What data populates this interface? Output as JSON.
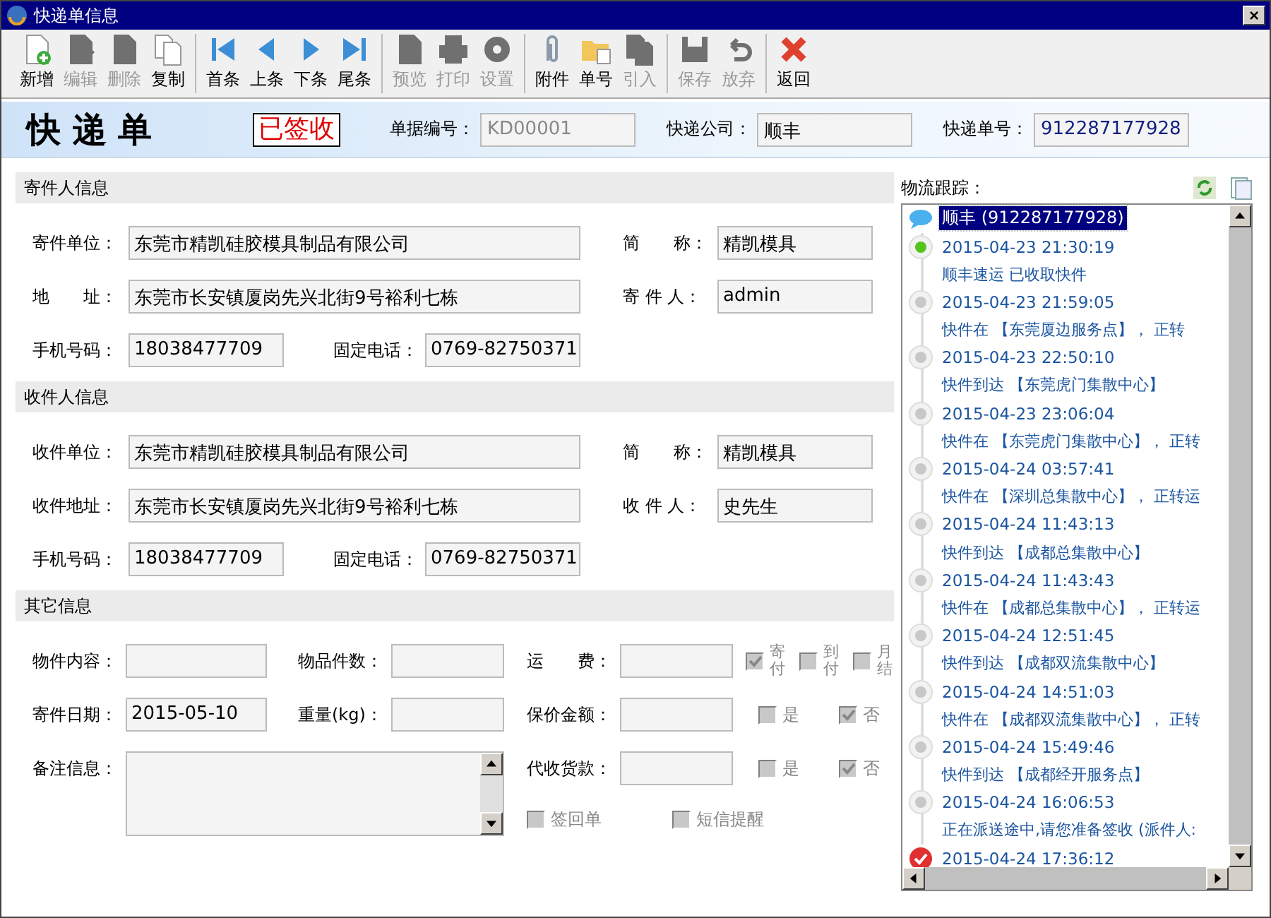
{
  "window": {
    "title": "快递单信息",
    "close": "×"
  },
  "toolbar": {
    "groups": [
      [
        {
          "label": "新增",
          "kind": "new",
          "disabled": false
        },
        {
          "label": "编辑",
          "kind": "edit",
          "disabled": true
        },
        {
          "label": "删除",
          "kind": "delete",
          "disabled": true
        },
        {
          "label": "复制",
          "kind": "copy",
          "disabled": false
        }
      ],
      [
        {
          "label": "首条",
          "kind": "first",
          "disabled": false
        },
        {
          "label": "上条",
          "kind": "previous",
          "disabled": false
        },
        {
          "label": "下条",
          "kind": "next",
          "disabled": false
        },
        {
          "label": "尾条",
          "kind": "last",
          "disabled": false
        }
      ],
      [
        {
          "label": "预览",
          "kind": "preview",
          "disabled": true
        },
        {
          "label": "打印",
          "kind": "print",
          "disabled": true
        },
        {
          "label": "设置",
          "kind": "settings",
          "disabled": true
        }
      ],
      [
        {
          "label": "附件",
          "kind": "attachment",
          "disabled": false
        },
        {
          "label": "单号",
          "kind": "number",
          "disabled": false
        },
        {
          "label": "引入",
          "kind": "import",
          "disabled": true
        }
      ],
      [
        {
          "label": "保存",
          "kind": "save",
          "disabled": true
        },
        {
          "label": "放弃",
          "kind": "discard",
          "disabled": true
        }
      ],
      [
        {
          "label": "返回",
          "kind": "back",
          "disabled": false
        }
      ]
    ]
  },
  "header": {
    "title": "快 递 单",
    "status": "已签收",
    "fields": [
      {
        "label": "单据编号：",
        "value": "KD00001",
        "disabled": true
      },
      {
        "label": "快递公司：",
        "value": "顺丰",
        "disabled": false
      },
      {
        "label": "快递单号：",
        "value": "912287177928",
        "disabled": false
      }
    ]
  },
  "sender": {
    "title": "寄件人信息",
    "rows": [
      [
        {
          "label": "寄件单位：",
          "value": "东莞市精凯硅胶模具制品有限公司"
        },
        {
          "label": "简　　称：",
          "value": "精凯模具"
        }
      ],
      [
        {
          "label": "地　　址：",
          "value": "东莞市长安镇厦岗先兴北街9号裕利七栋"
        },
        {
          "label": "寄 件 人：",
          "value": "admin"
        }
      ],
      [
        {
          "label": "手机号码：",
          "value": "18038477709"
        },
        {
          "label": "固定电话：",
          "value": "0769-82750371"
        }
      ]
    ]
  },
  "receiver": {
    "title": "收件人信息",
    "rows": [
      [
        {
          "label": "收件单位：",
          "value": "东莞市精凯硅胶模具制品有限公司"
        },
        {
          "label": "简　　称：",
          "value": "精凯模具"
        }
      ],
      [
        {
          "label": "收件地址：",
          "value": "东莞市长安镇厦岗先兴北街9号裕利七栋"
        },
        {
          "label": "收 件 人：",
          "value": "史先生"
        }
      ],
      [
        {
          "label": "手机号码：",
          "value": "18038477709"
        },
        {
          "label": "固定电话：",
          "value": "0769-82750371"
        }
      ]
    ]
  },
  "other": {
    "title": "其它信息",
    "contents": {
      "label": "物件内容："
    },
    "count": {
      "label": "物品件数："
    },
    "freight": {
      "label": "运　　费：",
      "options": [
        {
          "label": "寄付",
          "checked": true
        },
        {
          "label": "到付",
          "checked": false
        },
        {
          "label": "月结",
          "checked": false
        }
      ]
    },
    "date": {
      "label": "寄件日期：",
      "value": "2015-05-10"
    },
    "weight": {
      "label": "重量(kg)："
    },
    "insured": {
      "label": "保价金额：",
      "options": [
        {
          "label": "是",
          "checked": false
        },
        {
          "label": "否",
          "checked": true
        }
      ]
    },
    "notes": {
      "label": "备注信息："
    },
    "cod": {
      "label": "代收货款：",
      "options": [
        {
          "label": "是",
          "checked": false
        },
        {
          "label": "否",
          "checked": true
        }
      ]
    },
    "extras": [
      {
        "label": "签回单",
        "checked": false
      },
      {
        "label": "短信提醒",
        "checked": false
      }
    ]
  },
  "tracking": {
    "title": "物流跟踪：",
    "header": {
      "text": "顺丰 (912287177928)",
      "selected": true
    },
    "events": [
      {
        "kind": "received",
        "time": "2015-04-23 21:30:19",
        "text": "顺丰速运 已收取快件"
      },
      {
        "kind": "transit",
        "time": "2015-04-23 21:59:05",
        "text": "快件在 【东莞厦边服务点】， 正转"
      },
      {
        "kind": "transit",
        "time": "2015-04-23 22:50:10",
        "text": "快件到达 【东莞虎门集散中心】"
      },
      {
        "kind": "transit",
        "time": "2015-04-23 23:06:04",
        "text": "快件在 【东莞虎门集散中心】， 正转"
      },
      {
        "kind": "transit",
        "time": "2015-04-24 03:57:41",
        "text": "快件在 【深圳总集散中心】， 正转运"
      },
      {
        "kind": "transit",
        "time": "2015-04-24 11:43:13",
        "text": "快件到达 【成都总集散中心】"
      },
      {
        "kind": "transit",
        "time": "2015-04-24 11:43:43",
        "text": "快件在 【成都总集散中心】， 正转运"
      },
      {
        "kind": "transit",
        "time": "2015-04-24 12:51:45",
        "text": "快件到达 【成都双流集散中心】"
      },
      {
        "kind": "transit",
        "time": "2015-04-24 14:51:03",
        "text": "快件在 【成都双流集散中心】， 正转"
      },
      {
        "kind": "transit",
        "time": "2015-04-24 15:49:46",
        "text": "快件到达 【成都经开服务点】"
      },
      {
        "kind": "transit",
        "time": "2015-04-24 16:06:53",
        "text": "正在派送途中,请您准备签收 (派件人:"
      },
      {
        "kind": "signed",
        "time": "2015-04-24 17:36:12"
      }
    ]
  }
}
